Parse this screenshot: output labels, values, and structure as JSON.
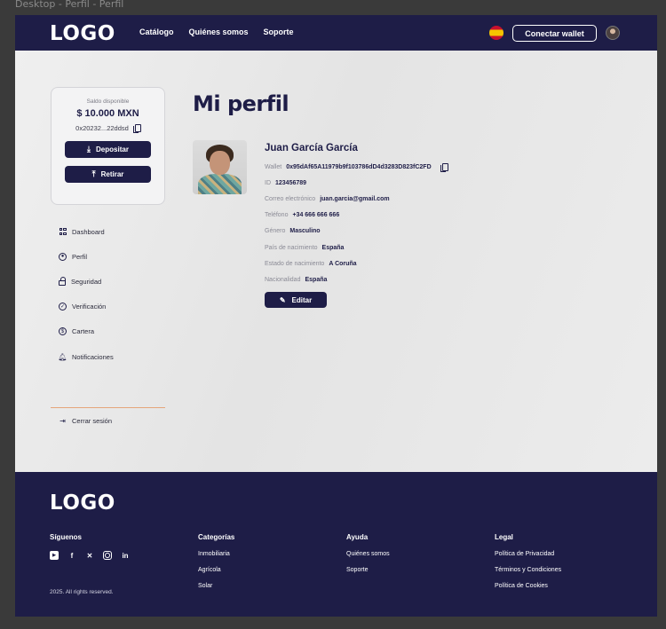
{
  "window": {
    "title": "Desktop - Perfil - Perfil"
  },
  "nav": {
    "logo": "LOGO",
    "links": [
      "Catálogo",
      "Quiénes somos",
      "Soporte"
    ],
    "connect_label": "Conectar wallet"
  },
  "balance": {
    "label": "Saldo disponible",
    "amount": "$ 10.000 MXN",
    "address": "0x20232...22ddsd",
    "deposit_label": "Depositar",
    "withdraw_label": "Retirar"
  },
  "sidebar": {
    "items": [
      {
        "label": "Dashboard",
        "icon": "dashboard-icon"
      },
      {
        "label": "Perfil",
        "icon": "user-icon"
      },
      {
        "label": "Seguridad",
        "icon": "lock-icon"
      },
      {
        "label": "Verificación",
        "icon": "check-circle-icon"
      },
      {
        "label": "Cartera",
        "icon": "dollar-icon"
      },
      {
        "label": "Notificaciones",
        "icon": "bell-icon"
      }
    ],
    "logout_label": "Cerrar sesión"
  },
  "profile": {
    "page_title": "Mi perfil",
    "name": "Juan García García",
    "fields": [
      {
        "key": "Wallet",
        "value": "0x95dAf65A11979b9f103786dD4d3283D823fC2FD"
      },
      {
        "key": "ID",
        "value": "123456789"
      },
      {
        "key": "Correo electrónico",
        "value": "juan.garcia@gmail.com"
      },
      {
        "key": "Teléfono",
        "value": "+34 666 666 666"
      },
      {
        "key": "Género",
        "value": "Masculino"
      },
      {
        "key": "País de nacimiento",
        "value": "España"
      },
      {
        "key": "Estado de nacimiento",
        "value": "A Coruña"
      },
      {
        "key": "Nacionalidad",
        "value": "España"
      }
    ],
    "edit_label": "Editar"
  },
  "footer": {
    "logo": "LOGO",
    "follow_heading": "Síguenos",
    "socials": [
      "youtube-icon",
      "facebook-icon",
      "x-icon",
      "instagram-icon",
      "linkedin-icon"
    ],
    "copyright": "2025. All rights reserved.",
    "columns": [
      {
        "heading": "Categorías",
        "links": [
          "Inmobiliaria",
          "Agrícola",
          "Solar"
        ]
      },
      {
        "heading": "Ayuda",
        "links": [
          "Quiénes somos",
          "Soporte"
        ]
      },
      {
        "heading": "Legal",
        "links": [
          "Política de Privacidad",
          "Términos y Condiciones",
          "Política de Cookies"
        ]
      }
    ]
  },
  "colors": {
    "primary": "#1e1d47",
    "divider": "#e5a57a",
    "background": "#ececec"
  }
}
